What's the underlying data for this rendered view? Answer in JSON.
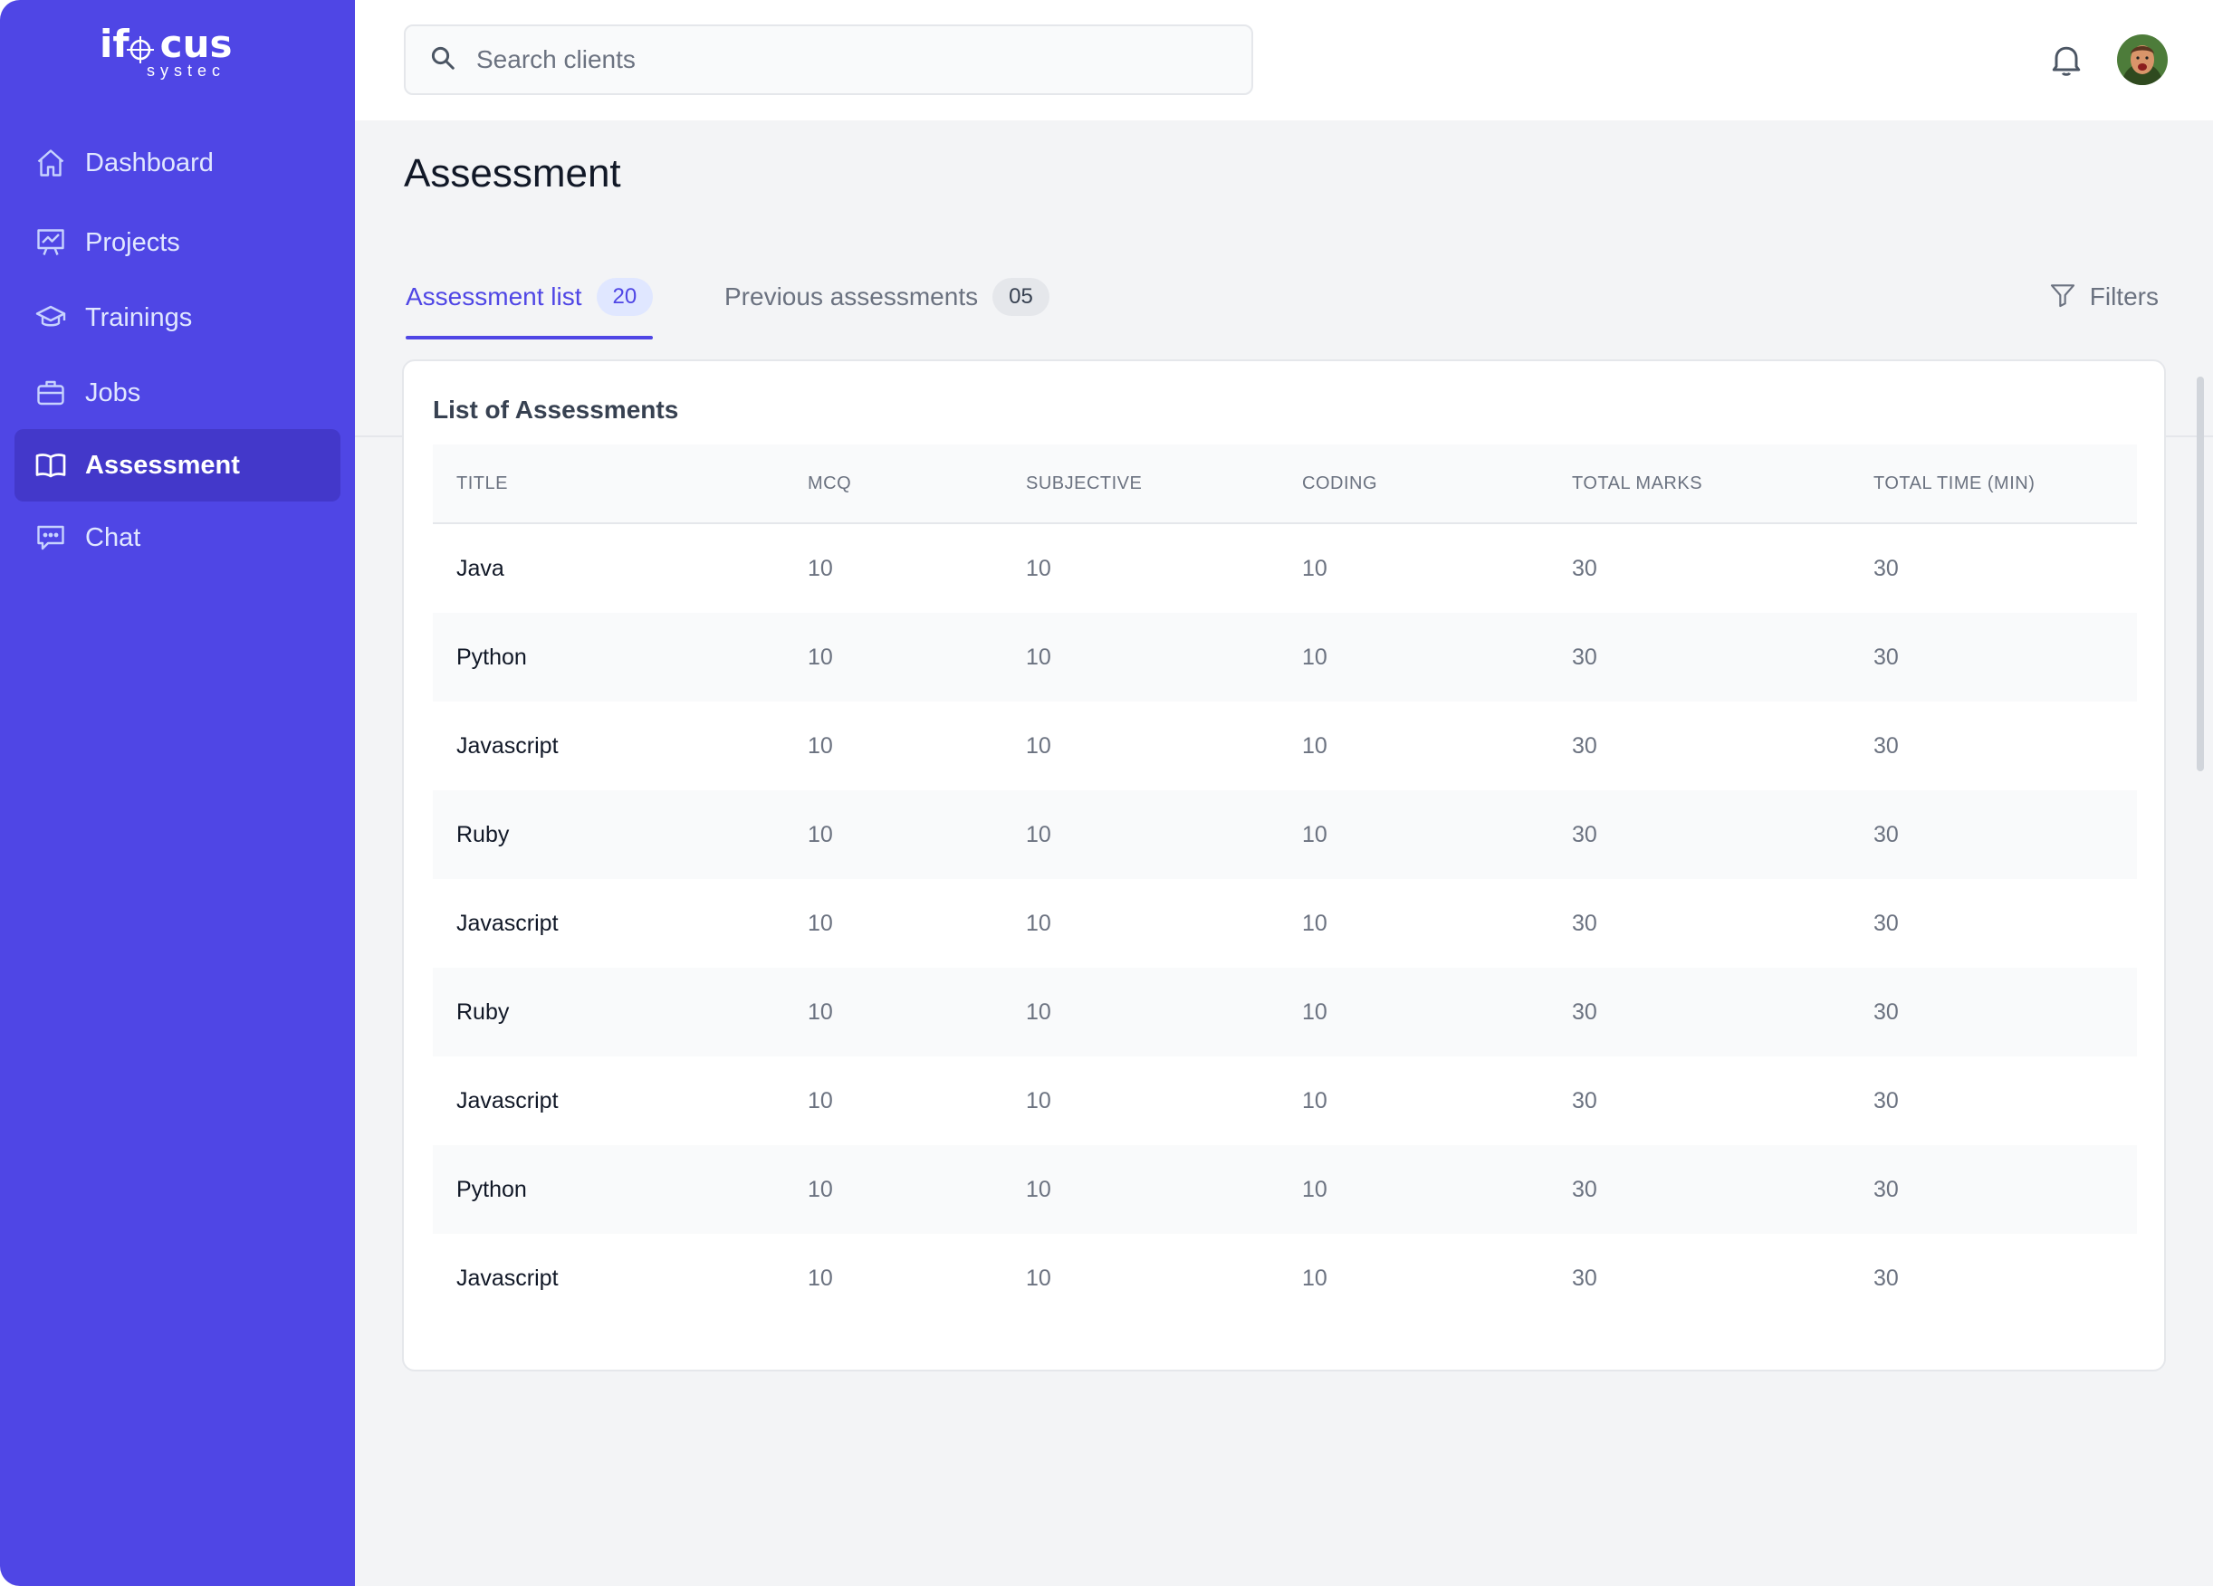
{
  "app": {
    "logo_text_left": "if",
    "logo_text_right": "cus",
    "logo_sub": "systec",
    "accent_color": "#4f46e5"
  },
  "sidebar": {
    "items": [
      {
        "label": "Dashboard",
        "icon": "home-icon"
      },
      {
        "label": "Projects",
        "icon": "presentation-chart-icon"
      },
      {
        "label": "Trainings",
        "icon": "graduation-cap-icon"
      },
      {
        "label": "Jobs",
        "icon": "briefcase-icon"
      },
      {
        "label": "Assessment",
        "icon": "book-open-icon",
        "active": true
      },
      {
        "label": "Chat",
        "icon": "chat-icon"
      }
    ]
  },
  "topbar": {
    "search_placeholder": "Search clients"
  },
  "page": {
    "title": "Assessment",
    "tabs": [
      {
        "label": "Assessment list",
        "count": "20",
        "active": true
      },
      {
        "label": "Previous assessments",
        "count": "05",
        "active": false
      }
    ],
    "filters_label": "Filters"
  },
  "table": {
    "card_title": "List of Assessments",
    "columns": [
      "TITLE",
      "MCQ",
      "SUBJECTIVE",
      "CODING",
      "TOTAL MARKS",
      "TOTAL TIME (MIN)"
    ],
    "rows": [
      [
        "Java",
        "10",
        "10",
        "10",
        "30",
        "30"
      ],
      [
        "Python",
        "10",
        "10",
        "10",
        "30",
        "30"
      ],
      [
        "Javascript",
        "10",
        "10",
        "10",
        "30",
        "30"
      ],
      [
        "Ruby",
        "10",
        "10",
        "10",
        "30",
        "30"
      ],
      [
        "Javascript",
        "10",
        "10",
        "10",
        "30",
        "30"
      ],
      [
        "Ruby",
        "10",
        "10",
        "10",
        "30",
        "30"
      ],
      [
        "Javascript",
        "10",
        "10",
        "10",
        "30",
        "30"
      ],
      [
        "Python",
        "10",
        "10",
        "10",
        "30",
        "30"
      ],
      [
        "Javascript",
        "10",
        "10",
        "10",
        "30",
        "30"
      ]
    ]
  }
}
